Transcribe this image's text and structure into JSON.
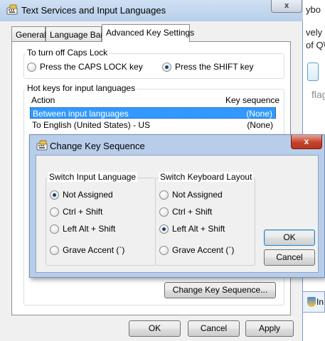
{
  "background_window": {
    "lines": [
      "ybo",
      "vely",
      "of Q\\",
      "flag",
      "In"
    ]
  },
  "main_dialog": {
    "title": "Text Services and Input Languages",
    "close_glyph": "x",
    "tabs": [
      {
        "label": "General",
        "active": false
      },
      {
        "label": "Language Bar",
        "active": false
      },
      {
        "label": "Advanced Key Settings",
        "active": true
      }
    ],
    "caps_lock": {
      "group_label": "To turn off Caps Lock",
      "options": [
        {
          "label": "Press the CAPS LOCK key",
          "checked": false
        },
        {
          "label": "Press the SHIFT key",
          "checked": true
        }
      ]
    },
    "hotkeys": {
      "group_label": "Hot keys for input languages",
      "columns": [
        "Action",
        "Key sequence"
      ],
      "rows": [
        {
          "action": "Between input languages",
          "sequence": "(None)",
          "selected": true
        },
        {
          "action": "To English (United States) - US",
          "sequence": "(None)",
          "selected": false
        }
      ],
      "change_button": "Change Key Sequence..."
    },
    "footer": {
      "ok": "OK",
      "cancel": "Cancel",
      "apply": "Apply"
    }
  },
  "change_key_dialog": {
    "title": "Change Key Sequence",
    "close_glyph": "x",
    "switch_input_language": {
      "label": "Switch Input Language",
      "options": [
        {
          "label": "Not Assigned",
          "checked": true
        },
        {
          "label": "Ctrl + Shift",
          "checked": false
        },
        {
          "label": "Left Alt + Shift",
          "checked": false
        },
        {
          "label": "Grave Accent (`)",
          "checked": false
        }
      ]
    },
    "switch_keyboard_layout": {
      "label": "Switch Keyboard Layout",
      "options": [
        {
          "label": "Not Assigned",
          "checked": false
        },
        {
          "label": "Ctrl + Shift",
          "checked": false
        },
        {
          "label": "Left Alt + Shift",
          "checked": true
        },
        {
          "label": "Grave Accent (`)",
          "checked": false
        }
      ]
    },
    "ok": "OK",
    "cancel": "Cancel"
  },
  "icons": {
    "title_icon": "keyboard-language-icon",
    "close": "close-icon"
  },
  "colors": {
    "selection": "#3399ff",
    "title_bar": "#b8cde9",
    "close_red": "#c5412a"
  }
}
